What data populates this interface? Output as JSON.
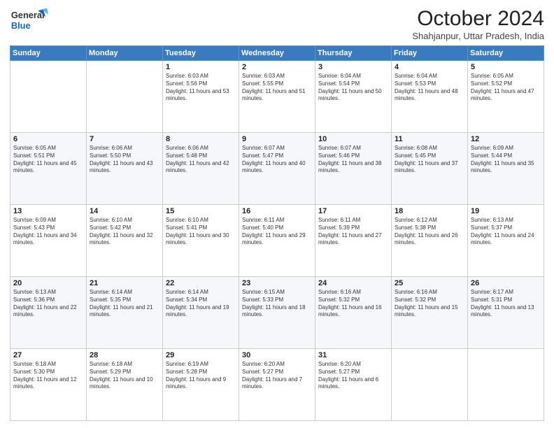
{
  "logo": {
    "general": "General",
    "blue": "Blue"
  },
  "header": {
    "title": "October 2024",
    "subtitle": "Shahjanpur, Uttar Pradesh, India"
  },
  "columns": [
    "Sunday",
    "Monday",
    "Tuesday",
    "Wednesday",
    "Thursday",
    "Friday",
    "Saturday"
  ],
  "weeks": [
    [
      {
        "day": "",
        "text": ""
      },
      {
        "day": "",
        "text": ""
      },
      {
        "day": "1",
        "text": "Sunrise: 6:03 AM\nSunset: 5:56 PM\nDaylight: 11 hours and 53 minutes."
      },
      {
        "day": "2",
        "text": "Sunrise: 6:03 AM\nSunset: 5:55 PM\nDaylight: 11 hours and 51 minutes."
      },
      {
        "day": "3",
        "text": "Sunrise: 6:04 AM\nSunset: 5:54 PM\nDaylight: 11 hours and 50 minutes."
      },
      {
        "day": "4",
        "text": "Sunrise: 6:04 AM\nSunset: 5:53 PM\nDaylight: 11 hours and 48 minutes."
      },
      {
        "day": "5",
        "text": "Sunrise: 6:05 AM\nSunset: 5:52 PM\nDaylight: 11 hours and 47 minutes."
      }
    ],
    [
      {
        "day": "6",
        "text": "Sunrise: 6:05 AM\nSunset: 5:51 PM\nDaylight: 11 hours and 45 minutes."
      },
      {
        "day": "7",
        "text": "Sunrise: 6:06 AM\nSunset: 5:50 PM\nDaylight: 11 hours and 43 minutes."
      },
      {
        "day": "8",
        "text": "Sunrise: 6:06 AM\nSunset: 5:48 PM\nDaylight: 11 hours and 42 minutes."
      },
      {
        "day": "9",
        "text": "Sunrise: 6:07 AM\nSunset: 5:47 PM\nDaylight: 11 hours and 40 minutes."
      },
      {
        "day": "10",
        "text": "Sunrise: 6:07 AM\nSunset: 5:46 PM\nDaylight: 11 hours and 38 minutes."
      },
      {
        "day": "11",
        "text": "Sunrise: 6:08 AM\nSunset: 5:45 PM\nDaylight: 11 hours and 37 minutes."
      },
      {
        "day": "12",
        "text": "Sunrise: 6:09 AM\nSunset: 5:44 PM\nDaylight: 11 hours and 35 minutes."
      }
    ],
    [
      {
        "day": "13",
        "text": "Sunrise: 6:09 AM\nSunset: 5:43 PM\nDaylight: 11 hours and 34 minutes."
      },
      {
        "day": "14",
        "text": "Sunrise: 6:10 AM\nSunset: 5:42 PM\nDaylight: 11 hours and 32 minutes."
      },
      {
        "day": "15",
        "text": "Sunrise: 6:10 AM\nSunset: 5:41 PM\nDaylight: 11 hours and 30 minutes."
      },
      {
        "day": "16",
        "text": "Sunrise: 6:11 AM\nSunset: 5:40 PM\nDaylight: 11 hours and 29 minutes."
      },
      {
        "day": "17",
        "text": "Sunrise: 6:11 AM\nSunset: 5:39 PM\nDaylight: 11 hours and 27 minutes."
      },
      {
        "day": "18",
        "text": "Sunrise: 6:12 AM\nSunset: 5:38 PM\nDaylight: 11 hours and 26 minutes."
      },
      {
        "day": "19",
        "text": "Sunrise: 6:13 AM\nSunset: 5:37 PM\nDaylight: 11 hours and 24 minutes."
      }
    ],
    [
      {
        "day": "20",
        "text": "Sunrise: 6:13 AM\nSunset: 5:36 PM\nDaylight: 11 hours and 22 minutes."
      },
      {
        "day": "21",
        "text": "Sunrise: 6:14 AM\nSunset: 5:35 PM\nDaylight: 11 hours and 21 minutes."
      },
      {
        "day": "22",
        "text": "Sunrise: 6:14 AM\nSunset: 5:34 PM\nDaylight: 11 hours and 19 minutes."
      },
      {
        "day": "23",
        "text": "Sunrise: 6:15 AM\nSunset: 5:33 PM\nDaylight: 11 hours and 18 minutes."
      },
      {
        "day": "24",
        "text": "Sunrise: 6:16 AM\nSunset: 5:32 PM\nDaylight: 11 hours and 16 minutes."
      },
      {
        "day": "25",
        "text": "Sunrise: 6:16 AM\nSunset: 5:32 PM\nDaylight: 11 hours and 15 minutes."
      },
      {
        "day": "26",
        "text": "Sunrise: 6:17 AM\nSunset: 5:31 PM\nDaylight: 11 hours and 13 minutes."
      }
    ],
    [
      {
        "day": "27",
        "text": "Sunrise: 6:18 AM\nSunset: 5:30 PM\nDaylight: 11 hours and 12 minutes."
      },
      {
        "day": "28",
        "text": "Sunrise: 6:18 AM\nSunset: 5:29 PM\nDaylight: 11 hours and 10 minutes."
      },
      {
        "day": "29",
        "text": "Sunrise: 6:19 AM\nSunset: 5:28 PM\nDaylight: 11 hours and 9 minutes."
      },
      {
        "day": "30",
        "text": "Sunrise: 6:20 AM\nSunset: 5:27 PM\nDaylight: 11 hours and 7 minutes."
      },
      {
        "day": "31",
        "text": "Sunrise: 6:20 AM\nSunset: 5:27 PM\nDaylight: 11 hours and 6 minutes."
      },
      {
        "day": "",
        "text": ""
      },
      {
        "day": "",
        "text": ""
      }
    ]
  ]
}
